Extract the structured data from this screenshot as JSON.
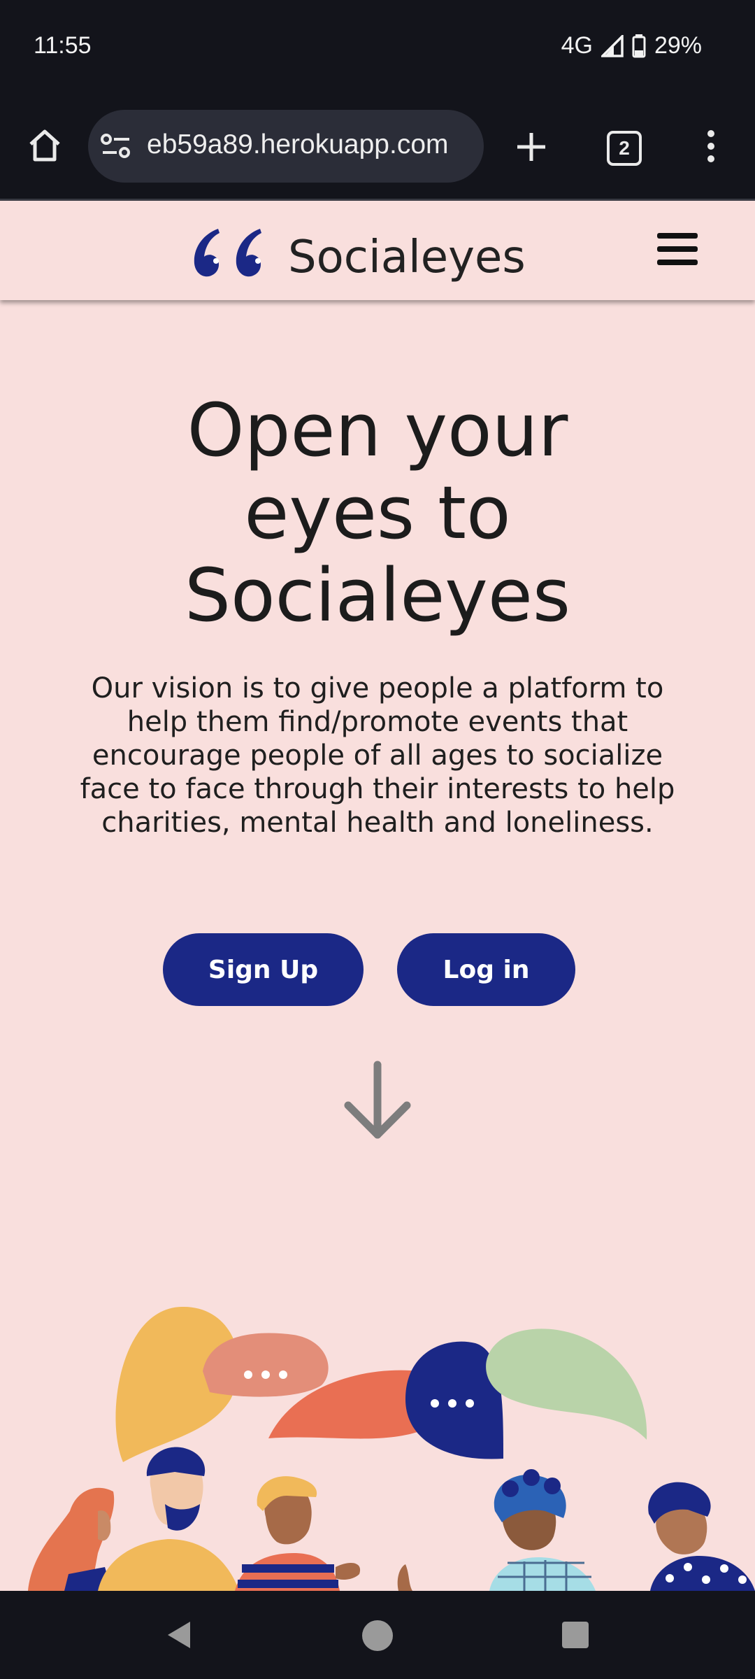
{
  "status_bar": {
    "time": "11:55",
    "network": "4G",
    "battery": "29%"
  },
  "browser": {
    "url": "eb59a89.herokuapp.com",
    "tab_count": "2",
    "icons": [
      "home-icon",
      "site-info-icon",
      "new-tab-icon",
      "tabs-icon",
      "more-options-icon"
    ]
  },
  "header": {
    "brand_name": "Socialeyes",
    "logo_color": "#1b2886",
    "menu_icon": "hamburger-icon"
  },
  "hero": {
    "title": "Open your eyes to Socialeyes",
    "description": "Our vision is to give people a platform to help them find/promote events that encourage people of all ages to socialize face to face through their interests to help charities, mental health and loneliness.",
    "signup_label": "Sign Up",
    "login_label": "Log in",
    "button_color": "#1b2886",
    "scroll_icon": "arrow-down-icon"
  },
  "nav": {
    "icons": [
      "back-icon",
      "home-circle-icon",
      "recents-icon"
    ]
  }
}
